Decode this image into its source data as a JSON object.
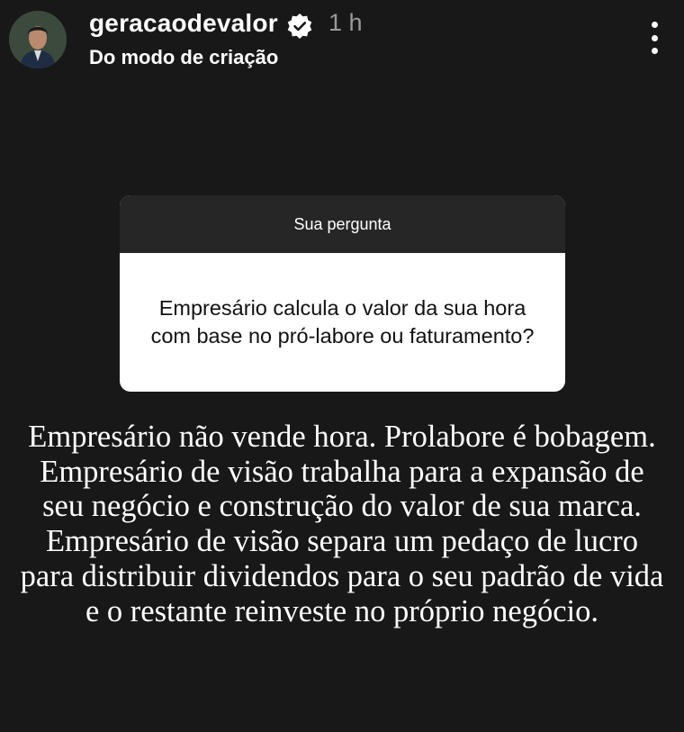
{
  "header": {
    "username": "geracaodevalor",
    "timestamp": "1 h",
    "subtitle": "Do modo de criação",
    "verified_icon": "verified-badge-icon",
    "more_icon": "more-vertical-icon"
  },
  "question_card": {
    "title": "Sua pergunta",
    "question": "Empresário calcula o valor da sua hora com base no pró-labore ou faturamento?"
  },
  "answer": {
    "text": "Empresário não vende hora. Prolabore é bobagem. Empresário de visão trabalha para a expansão de seu negócio e construção do valor de sua marca. Empresário de visão separa um pedaço de lucro para distribuir dividendos para o seu padrão de vida e o restante reinveste no próprio negócio."
  },
  "colors": {
    "background": "#181818",
    "card_header": "#262626",
    "card_body": "#ffffff",
    "timestamp": "#9a9a9a"
  }
}
